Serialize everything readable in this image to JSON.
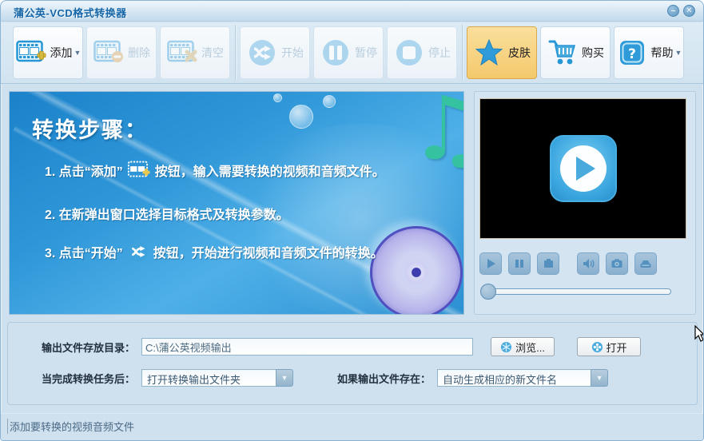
{
  "window": {
    "title": "蒲公英-VCD格式转换器",
    "minimize_glyph": "–",
    "close_glyph": "✕"
  },
  "toolbar": {
    "buttons": [
      {
        "label": "添加",
        "icon": "film-add-icon",
        "enabled": true,
        "has_dropdown": true
      },
      {
        "label": "删除",
        "icon": "film-remove-icon",
        "enabled": false,
        "has_dropdown": false
      },
      {
        "label": "清空",
        "icon": "film-clear-icon",
        "enabled": false,
        "has_dropdown": false
      },
      {
        "label": "开始",
        "icon": "convert-start-icon",
        "enabled": false,
        "has_dropdown": false
      },
      {
        "label": "暂停",
        "icon": "pause-icon",
        "enabled": false,
        "has_dropdown": false
      },
      {
        "label": "停止",
        "icon": "stop-icon",
        "enabled": false,
        "has_dropdown": false
      },
      {
        "label": "皮肤",
        "icon": "star-icon",
        "enabled": true,
        "highlighted": true,
        "has_dropdown": false
      },
      {
        "label": "购买",
        "icon": "cart-icon",
        "enabled": true,
        "has_dropdown": false
      },
      {
        "label": "帮助",
        "icon": "help-icon",
        "enabled": true,
        "has_dropdown": true
      }
    ]
  },
  "steps_panel": {
    "title": "转换步骤：",
    "steps": [
      {
        "prefix": "1. 点击“添加”",
        "icon": "film-add-icon",
        "suffix": "按钮，输入需要转换的视频和音频文件。"
      },
      {
        "prefix": "2. 在新弹出窗口选择目标格式及转换参数。",
        "suffix": ""
      },
      {
        "prefix": "3. 点击“开始”",
        "icon": "convert-start-icon",
        "suffix": "按钮，开始进行视频和音频文件的转换。"
      }
    ]
  },
  "preview": {
    "player_buttons": [
      "play",
      "pause",
      "stop",
      "volume",
      "snapshot",
      "open-tray"
    ],
    "slider_position": 0
  },
  "settings": {
    "output_dir_label": "输出文件存放目录：",
    "output_dir_value": "C:\\蒲公英视频输出",
    "browse_label": "浏览...",
    "open_label": "打开",
    "after_task_label": "当完成转换任务后：",
    "after_task_value": "打开转换输出文件夹",
    "if_exists_label": "如果输出文件存在：",
    "if_exists_value": "自动生成相应的新文件名"
  },
  "status_bar": {
    "text": "添加要转换的视频音频文件"
  },
  "colors": {
    "accent_blue": "#2e9ad8",
    "skin_highlight": "#f6cf7c",
    "panel_gradient_top": "#1b82ca",
    "note_teal": "#35c2a0",
    "cd_lavender": "#b6b2ea"
  }
}
